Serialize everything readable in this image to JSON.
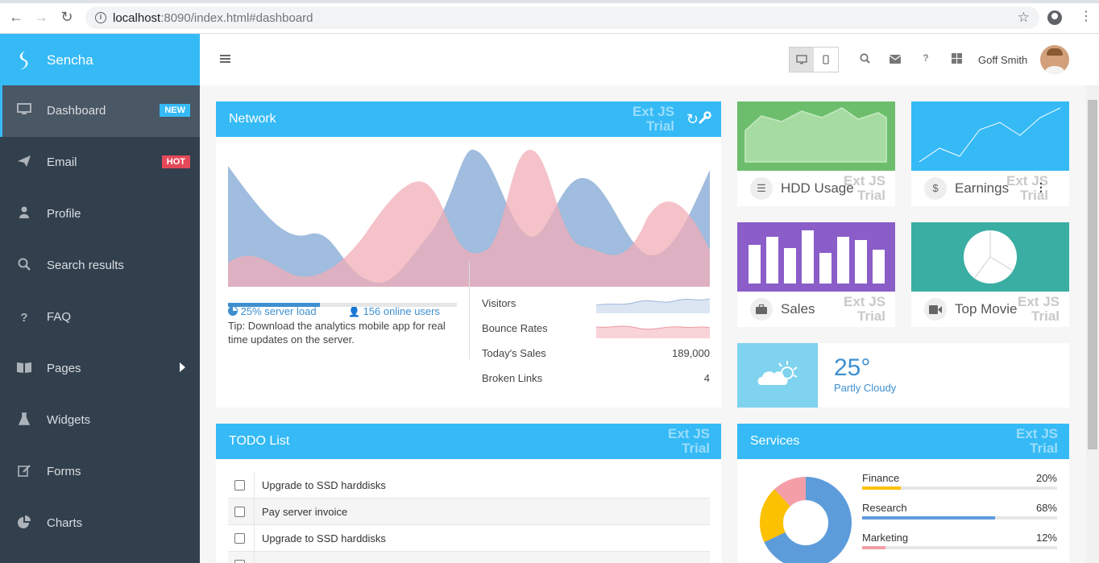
{
  "browser": {
    "url_host": "localhost",
    "url_path": ":8090/index.html#dashboard"
  },
  "sidebar": {
    "brand": "Sencha",
    "items": [
      {
        "label": "Dashboard",
        "icon": "desktop-icon",
        "badge": "NEW",
        "active": true
      },
      {
        "label": "Email",
        "icon": "paper-plane-icon",
        "badge": "HOT"
      },
      {
        "label": "Profile",
        "icon": "user-icon"
      },
      {
        "label": "Search results",
        "icon": "search-icon"
      },
      {
        "label": "FAQ",
        "icon": "question-icon"
      },
      {
        "label": "Pages",
        "icon": "book-icon",
        "has_submenu": true
      },
      {
        "label": "Widgets",
        "icon": "flask-icon"
      },
      {
        "label": "Forms",
        "icon": "edit-icon"
      },
      {
        "label": "Charts",
        "icon": "pie-chart-icon"
      }
    ]
  },
  "header": {
    "user_name": "Goff Smith"
  },
  "trial": {
    "line1": "Ext JS",
    "line2": "Trial"
  },
  "network": {
    "title": "Network",
    "server_load": "25% server load",
    "server_load_value": 0.4,
    "online_users": "156 online users",
    "tip": "Tip: Download the analytics mobile app for real time updates on the server.",
    "metrics": [
      {
        "label": "Visitors",
        "value": ""
      },
      {
        "label": "Bounce Rates",
        "value": ""
      },
      {
        "label": "Today's Sales",
        "value": "189,000"
      },
      {
        "label": "Broken Links",
        "value": "4"
      }
    ],
    "colors": {
      "blue": "#8fb0d8",
      "pink": "#f2adb7"
    }
  },
  "tiles": [
    {
      "label": "HDD Usage",
      "icon": "database-icon",
      "color": "#6dbe6c"
    },
    {
      "label": "Earnings",
      "icon": "dollar-icon",
      "color": "#35baf6"
    },
    {
      "label": "Sales",
      "icon": "briefcase-icon",
      "color": "#8a5dc8"
    },
    {
      "label": "Top Movie",
      "icon": "video-camera-icon",
      "color": "#3aaea3"
    }
  ],
  "weather": {
    "temperature": "25°",
    "condition": "Partly Cloudy"
  },
  "todo": {
    "title": "TODO List",
    "items": [
      "Upgrade to SSD harddisks",
      "Pay server invoice",
      "Upgrade to SSD harddisks"
    ]
  },
  "services": {
    "title": "Services",
    "items": [
      {
        "name": "Finance",
        "percent": "20%",
        "value": 20,
        "color": "#fcc100"
      },
      {
        "name": "Research",
        "percent": "68%",
        "value": 68,
        "color": "#5d9cdb"
      },
      {
        "name": "Marketing",
        "percent": "12%",
        "value": 12,
        "color": "#f49ea8"
      }
    ]
  }
}
